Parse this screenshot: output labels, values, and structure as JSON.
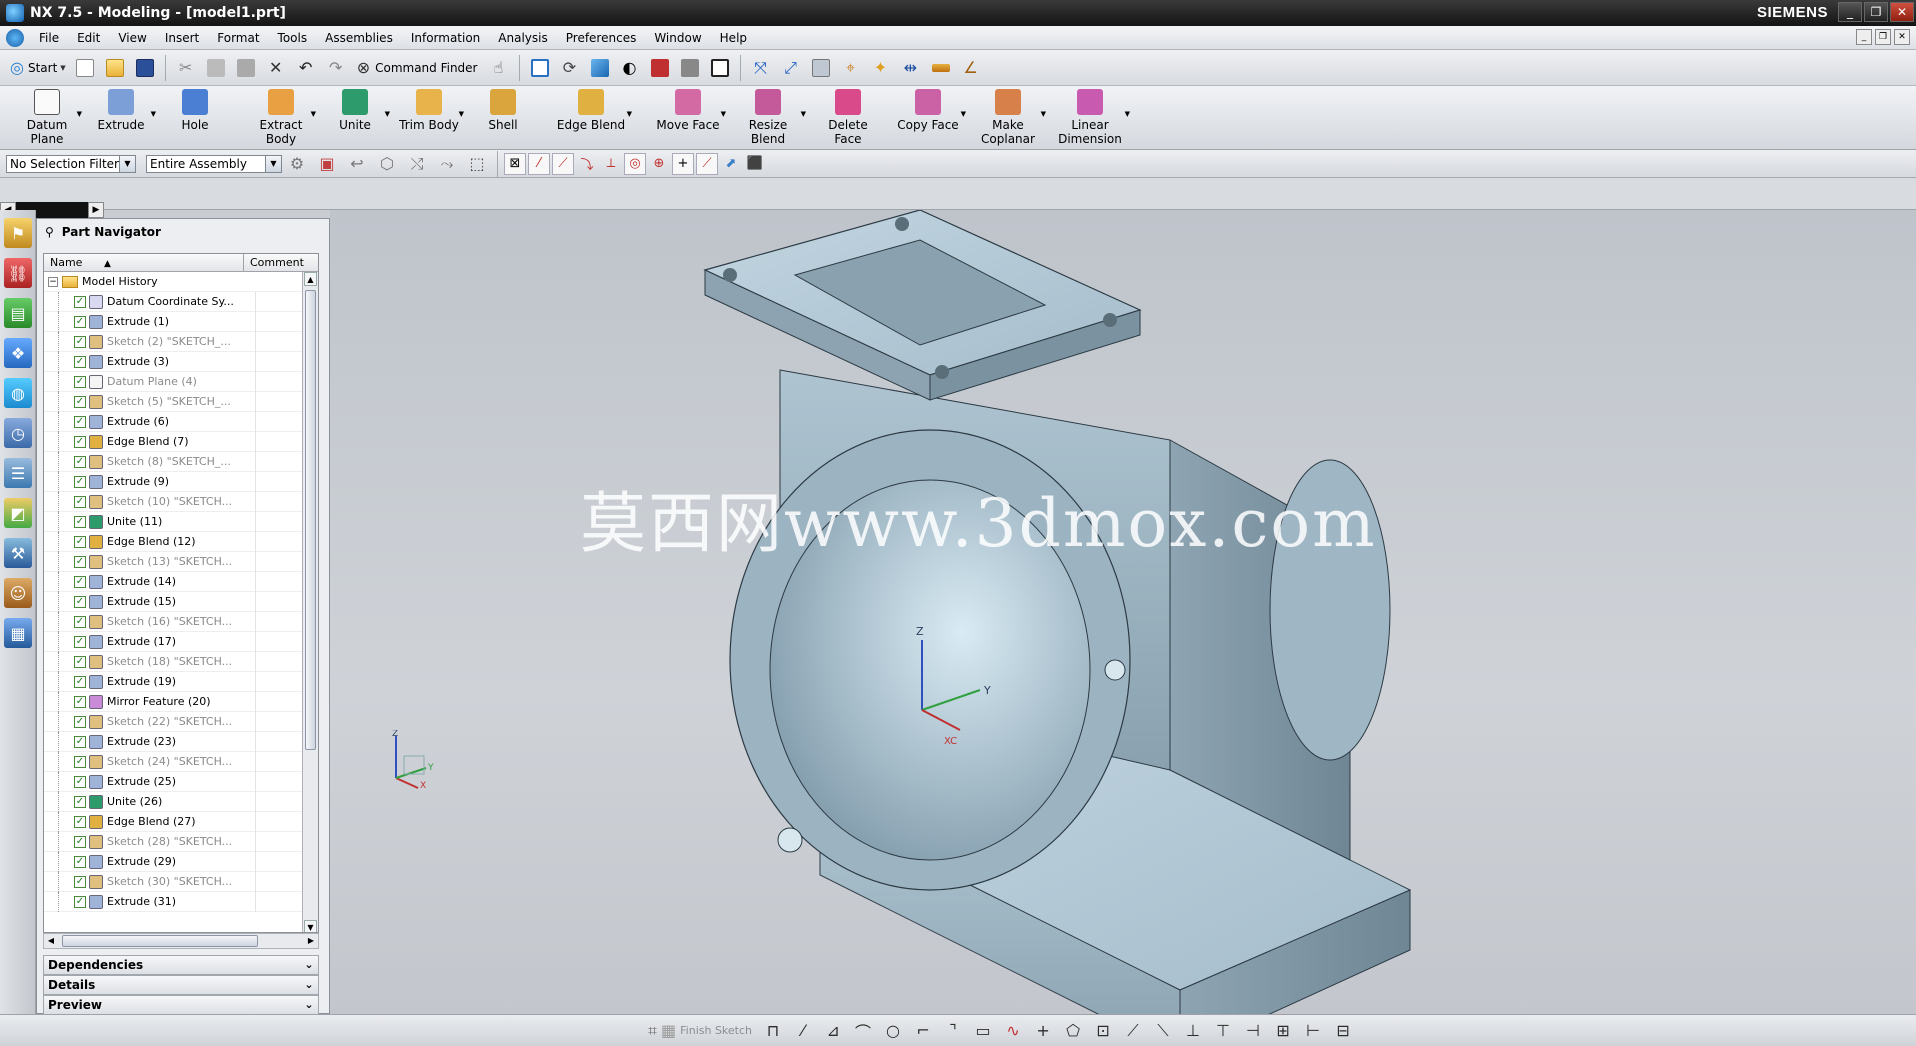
{
  "window": {
    "title": "NX 7.5 - Modeling - [model1.prt]",
    "brand": "SIEMENS",
    "controls": [
      "_",
      "❐",
      "✕"
    ]
  },
  "menu": {
    "items": [
      "File",
      "Edit",
      "View",
      "Insert",
      "Format",
      "Tools",
      "Assemblies",
      "Information",
      "Analysis",
      "Preferences",
      "Window",
      "Help"
    ]
  },
  "standard_toolbar": {
    "start_label": "Start",
    "command_finder_label": "Command Finder"
  },
  "ribbon": {
    "buttons": [
      {
        "label": "Datum\nPlane",
        "color": "#f5f5f5",
        "icon": "datum-plane-icon"
      },
      {
        "label": "Extrude",
        "color": "#7b9fd6",
        "icon": "extrude-icon"
      },
      {
        "label": "Hole",
        "color": "#4a7fd4",
        "icon": "hole-icon"
      },
      {
        "label": "Extract\nBody",
        "color": "#e8a043",
        "icon": "extract-body-icon"
      },
      {
        "label": "Unite",
        "color": "#2e9b6c",
        "icon": "unite-icon"
      },
      {
        "label": "Trim Body",
        "color": "#e8b34a",
        "icon": "trim-body-icon"
      },
      {
        "label": "Shell",
        "color": "#d9a53c",
        "icon": "shell-icon"
      },
      {
        "label": "Edge Blend",
        "color": "#e0b040",
        "icon": "edge-blend-icon"
      },
      {
        "label": "Move Face",
        "color": "#d46aa4",
        "icon": "move-face-icon"
      },
      {
        "label": "Resize\nBlend",
        "color": "#c45a9a",
        "icon": "resize-blend-icon"
      },
      {
        "label": "Delete\nFace",
        "color": "#d84a8a",
        "icon": "delete-face-icon"
      },
      {
        "label": "Copy Face",
        "color": "#cc62a6",
        "icon": "copy-face-icon"
      },
      {
        "label": "Make\nCoplanar",
        "color": "#d8804a",
        "icon": "make-coplanar-icon"
      },
      {
        "label": "Linear\nDimension",
        "color": "#c85ab0",
        "icon": "linear-dimension-icon"
      }
    ]
  },
  "selection_bar": {
    "filter_value": "No Selection Filter",
    "scope_value": "Entire Assembly"
  },
  "part_navigator": {
    "title": "Part Navigator",
    "columns": {
      "name": "Name",
      "comment": "Comment"
    },
    "root": "Model History",
    "features": [
      {
        "name": "Datum Coordinate Sy...",
        "dim": false,
        "type": "csys"
      },
      {
        "name": "Extrude (1)",
        "dim": false,
        "type": "extrude"
      },
      {
        "name": "Sketch (2) \"SKETCH_...",
        "dim": true,
        "type": "sketch"
      },
      {
        "name": "Extrude (3)",
        "dim": false,
        "type": "extrude"
      },
      {
        "name": "Datum Plane (4)",
        "dim": true,
        "type": "datum"
      },
      {
        "name": "Sketch (5) \"SKETCH_...",
        "dim": true,
        "type": "sketch"
      },
      {
        "name": "Extrude (6)",
        "dim": false,
        "type": "extrude"
      },
      {
        "name": "Edge Blend (7)",
        "dim": false,
        "type": "blend"
      },
      {
        "name": "Sketch (8) \"SKETCH_...",
        "dim": true,
        "type": "sketch"
      },
      {
        "name": "Extrude (9)",
        "dim": false,
        "type": "extrude"
      },
      {
        "name": "Sketch (10) \"SKETCH...",
        "dim": true,
        "type": "sketch"
      },
      {
        "name": "Unite (11)",
        "dim": false,
        "type": "unite"
      },
      {
        "name": "Edge Blend (12)",
        "dim": false,
        "type": "blend"
      },
      {
        "name": "Sketch (13) \"SKETCH...",
        "dim": true,
        "type": "sketch"
      },
      {
        "name": "Extrude (14)",
        "dim": false,
        "type": "extrude"
      },
      {
        "name": "Extrude (15)",
        "dim": false,
        "type": "extrude"
      },
      {
        "name": "Sketch (16) \"SKETCH...",
        "dim": true,
        "type": "sketch"
      },
      {
        "name": "Extrude (17)",
        "dim": false,
        "type": "extrude"
      },
      {
        "name": "Sketch (18) \"SKETCH...",
        "dim": true,
        "type": "sketch"
      },
      {
        "name": "Extrude (19)",
        "dim": false,
        "type": "extrude"
      },
      {
        "name": "Mirror Feature (20)",
        "dim": false,
        "type": "mirror"
      },
      {
        "name": "Sketch (22) \"SKETCH...",
        "dim": true,
        "type": "sketch"
      },
      {
        "name": "Extrude (23)",
        "dim": false,
        "type": "extrude"
      },
      {
        "name": "Sketch (24) \"SKETCH...",
        "dim": true,
        "type": "sketch"
      },
      {
        "name": "Extrude (25)",
        "dim": false,
        "type": "extrude"
      },
      {
        "name": "Unite (26)",
        "dim": false,
        "type": "unite"
      },
      {
        "name": "Edge Blend (27)",
        "dim": false,
        "type": "blend"
      },
      {
        "name": "Sketch (28) \"SKETCH...",
        "dim": true,
        "type": "sketch"
      },
      {
        "name": "Extrude (29)",
        "dim": false,
        "type": "extrude"
      },
      {
        "name": "Sketch (30) \"SKETCH...",
        "dim": true,
        "type": "sketch"
      },
      {
        "name": "Extrude (31)",
        "dim": false,
        "type": "extrude"
      }
    ],
    "panels": [
      "Dependencies",
      "Details",
      "Preview"
    ]
  },
  "graphics": {
    "watermark": "莫西网www.3dmox.com",
    "axis_labels": {
      "x": "X",
      "y": "Y",
      "z": "Z",
      "xc": "XC"
    },
    "model_color": "#a8bfcc"
  },
  "bottom_toolbar": {
    "finish_sketch_label": "Finish Sketch"
  }
}
